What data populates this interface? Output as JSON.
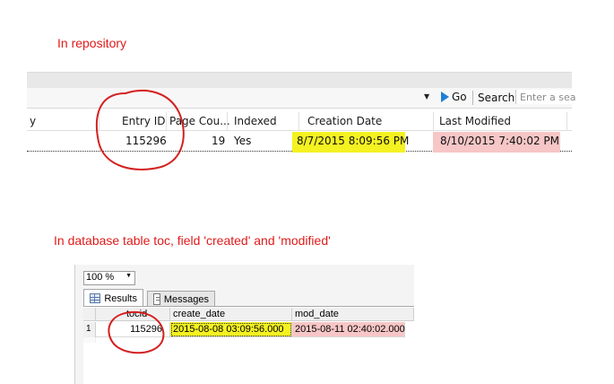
{
  "headings": {
    "repository": "In repository",
    "database": "In database table toc, field 'created' and 'modified'"
  },
  "repository": {
    "toolbar": {
      "go_label": "Go",
      "search_label": "Search:",
      "search_placeholder": "Enter a sear"
    },
    "columns": [
      "y",
      "Entry ID",
      "Page Cou...",
      "Indexed",
      "Creation Date",
      "Last Modified"
    ],
    "row": {
      "entry_id": "115296",
      "page_count": "19",
      "indexed": "Yes",
      "creation_date": "8/7/2015 8:09:56 PM",
      "last_modified": "8/10/2015 7:40:02 PM"
    }
  },
  "sql": {
    "zoom": "100 %",
    "tabs": [
      "Results",
      "Messages"
    ],
    "columns": [
      "tocid",
      "create_date",
      "mod_date"
    ],
    "rows": [
      {
        "row_number": "1",
        "tocid": "115296",
        "create_date": "2015-08-08 03:09:56.000",
        "mod_date": "2015-08-11 02:40:02.000"
      }
    ]
  },
  "colors": {
    "heading": "#e11a1a",
    "highlight_created": "#f4f221",
    "highlight_modified": "#f7c6c6",
    "circle": "#d42020",
    "go_arrow": "#1f7fd6"
  }
}
